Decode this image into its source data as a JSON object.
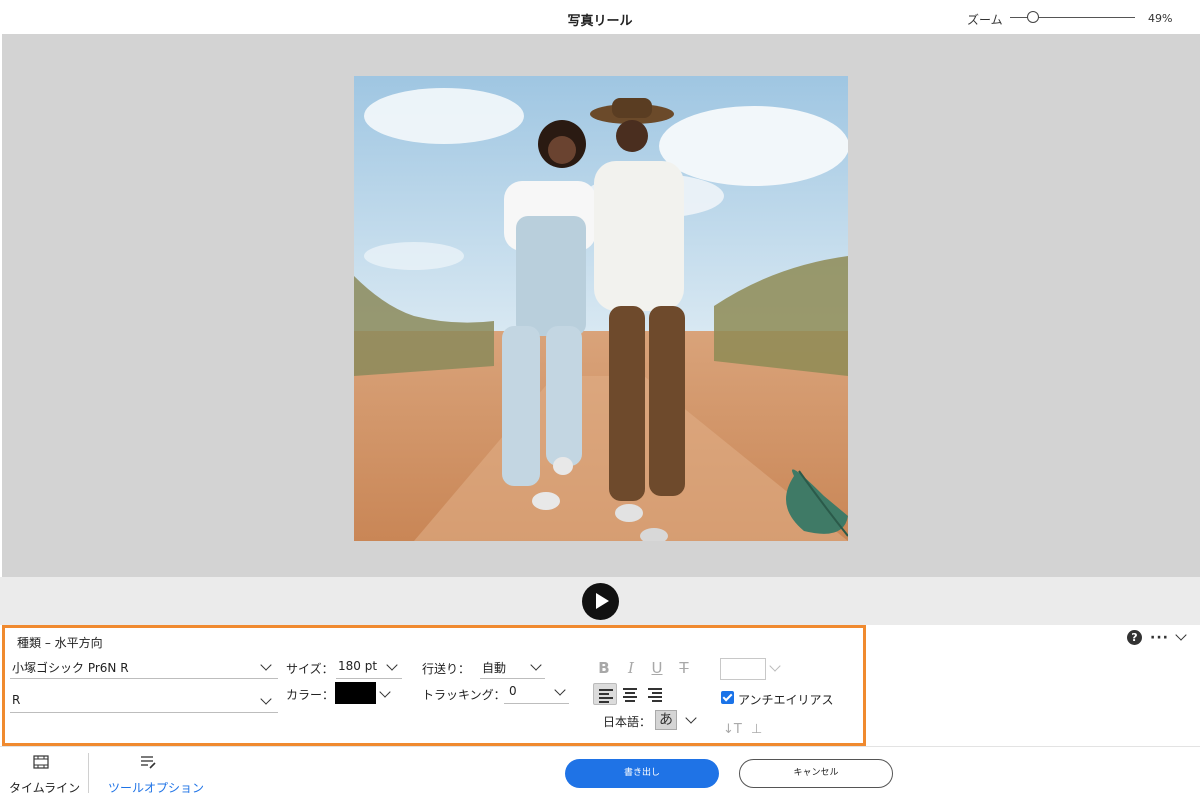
{
  "header": {
    "title": "写真リール",
    "zoom_label": "ズーム",
    "zoom_value": "49%",
    "zoom_level": 0.15
  },
  "player": {
    "play_icon": "play-icon"
  },
  "tool_options": {
    "panel_title": "種類 – 水平方向",
    "font_family": "小塚ゴシック Pr6N R",
    "font_style": "R",
    "size_label": "サイズ：",
    "size_value": "180 pt",
    "color_label": "カラー：",
    "color_value": "#000000",
    "leading_label": "行送り：",
    "leading_value": "自動",
    "tracking_label": "トラッキング：",
    "tracking_value": "0",
    "bold_label": "B",
    "italic_label": "I",
    "underline_label": "U",
    "strike_label": "T",
    "language_label": "日本語：",
    "language_glyph": "あ",
    "antialias_label": "アンチエイリアス",
    "antialias_checked": true,
    "accent_color": "#f08a2f"
  },
  "bottom_bar": {
    "timeline_label": "タイムライン",
    "tool_options_label": "ツールオプション",
    "export_label": "書き出し",
    "cancel_label": "キャンセル",
    "active_tab_color": "#1f73e6"
  }
}
